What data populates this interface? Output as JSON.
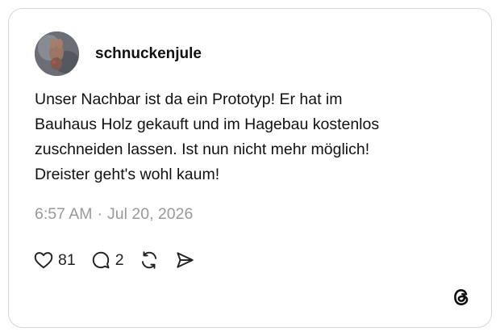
{
  "post": {
    "username": "schnuckenjule",
    "text": "Unser Nachbar ist da ein Prototyp! Er hat im\nBauhaus Holz gekauft und im Hagebau kostenlos\nzuschneiden lassen. Ist nun nicht mehr möglich!\nDreister geht's wohl kaum!",
    "time": "6:57 AM",
    "separator": "·",
    "date": "Jul 20, 2026"
  },
  "actions": {
    "likes": "81",
    "replies": "2",
    "like_icon": "heart-icon",
    "reply_icon": "comment-bubble-icon",
    "repost_icon": "repost-icon",
    "share_icon": "send-icon"
  },
  "brand": {
    "logo_icon": "threads-logo-icon"
  }
}
